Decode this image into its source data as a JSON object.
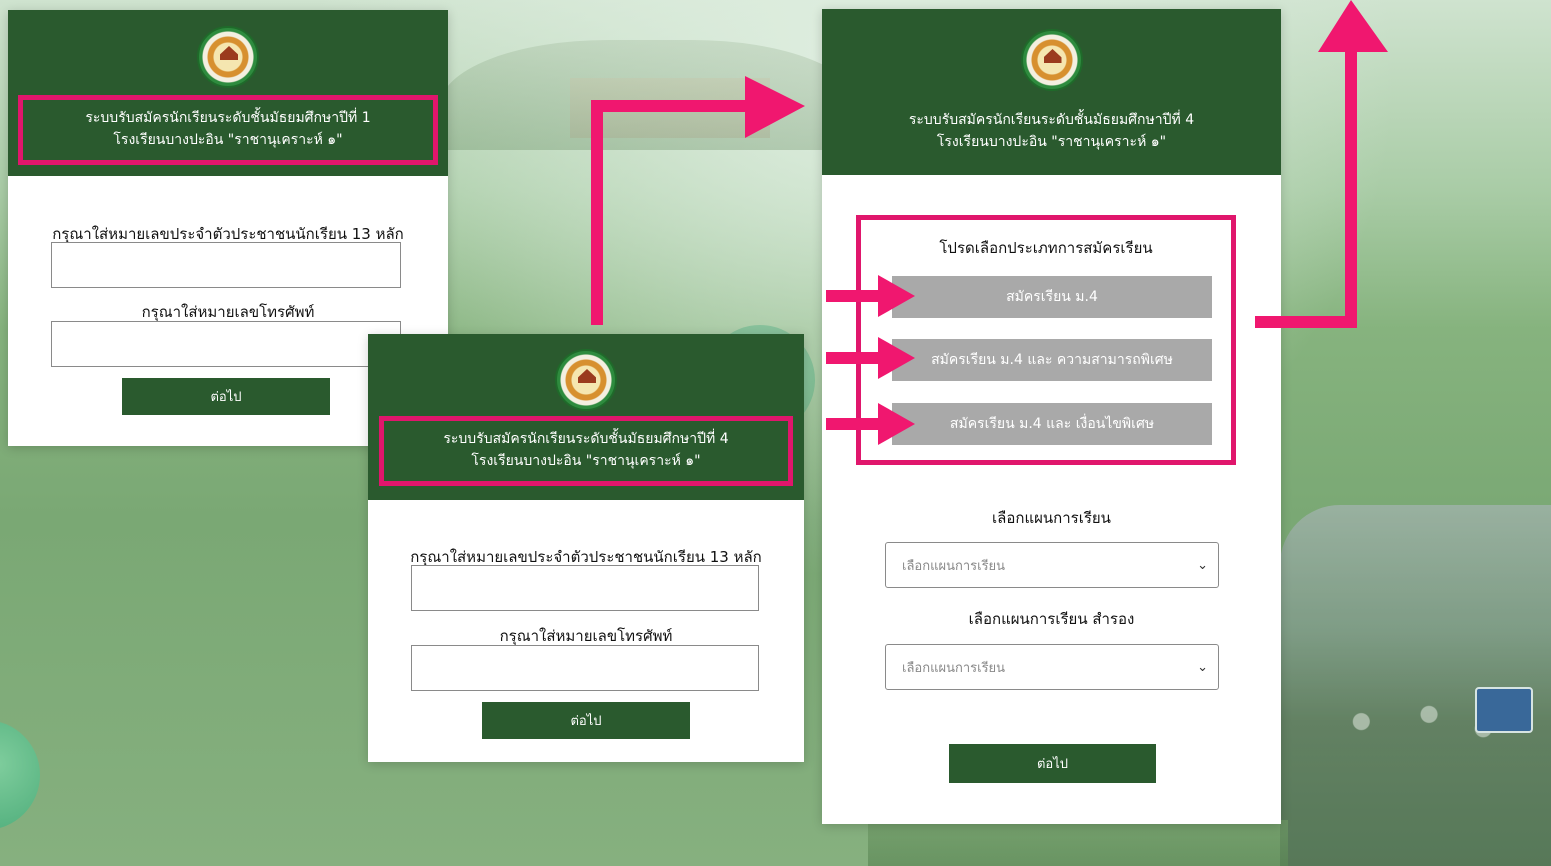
{
  "card1": {
    "title_line1": "ระบบรับสมัครนักเรียนระดับชั้นมัธยมศึกษาปีที่ 1",
    "title_line2": "โรงเรียนบางปะอิน \"ราชานุเคราะห์ ๑\"",
    "id_label": "กรุณาใส่หมายเลขประจำตัวประชาชนนักเรียน 13 หลัก",
    "phone_label": "กรุณาใส่หมายเลขโทรศัพท์",
    "next_label": "ต่อไป"
  },
  "card2": {
    "title_line1": "ระบบรับสมัครนักเรียนระดับชั้นมัธยมศึกษาปีที่ 4",
    "title_line2": "โรงเรียนบางปะอิน \"ราชานุเคราะห์ ๑\"",
    "id_label": "กรุณาใส่หมายเลขประจำตัวประชาชนนักเรียน 13 หลัก",
    "phone_label": "กรุณาใส่หมายเลขโทรศัพท์",
    "next_label": "ต่อไป"
  },
  "card3": {
    "title_line1": "ระบบรับสมัครนักเรียนระดับชั้นมัธยมศึกษาปีที่ 4",
    "title_line2": "โรงเรียนบางปะอิน \"ราชานุเคราะห์ ๑\"",
    "type_title": "โปรดเลือกประเภทการสมัครเรียน",
    "options": [
      "สมัครเรียน ม.4",
      "สมัครเรียน ม.4 และ ความสามารถพิเศษ",
      "สมัครเรียน ม.4 และ เงื่อนไขพิเศษ"
    ],
    "plan_label": "เลือกแผนการเรียน",
    "plan_placeholder": "เลือกแผนการเรียน",
    "plan2_label": "เลือกแผนการเรียน สำรอง",
    "plan2_placeholder": "เลือกแผนการเรียน",
    "next_label": "ต่อไป"
  },
  "colors": {
    "header_green": "#2a5a2e",
    "highlight_pink": "#e0166c",
    "option_gray": "#a9a9a9"
  }
}
